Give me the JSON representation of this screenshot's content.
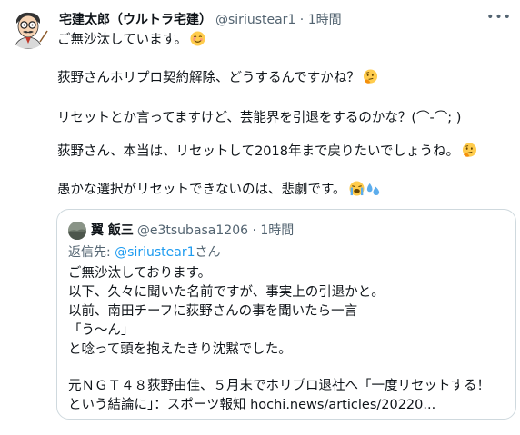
{
  "tweet": {
    "author_name": "宅建太郎（ウルトラ宅建）",
    "handle": "@siriustear1",
    "separator": "·",
    "time": "1時間",
    "lines": [
      "ご無沙汰しています。",
      "荻野さんホリプロ契約解除、どうするんですかね？",
      "リセットとか言ってますけど、芸能界を引退をするのかな？(⌒-⌒; )",
      "荻野さん、本当は、リセットして2018年まで戻りたいでしょうね。",
      "愚かな選択がリセットできないのは、悲劇です。"
    ],
    "emojis": [
      "smiling-face-emoji",
      "thinking-face-emoji",
      "thinking-face-emoji",
      "loudly-crying-face-emoji",
      "sweat-droplets-emoji"
    ]
  },
  "quoted_tweet": {
    "author_name": "翼 飯三",
    "handle": "@e3tsubasa1206",
    "separator": "·",
    "time": "1時間",
    "reply_prefix": "返信先: ",
    "reply_to": "@siriustear1",
    "reply_suffix": "さん",
    "lines": [
      "ご無沙汰しております。",
      "以下、久々に聞いた名前ですが、事実上の引退かと。",
      "以前、南田チーフに荻野さんの事を聞いたら一言",
      "「う～ん」",
      "と唸って頭を抱えたきり沈黙でした。",
      "元ＮＧＴ４８荻野由佳、５月末でホリプロ退社へ「一度リセットする！",
      "という結論に」：スポーツ報知 hochi.news/articles/20220..."
    ]
  },
  "icons": {
    "more": "more-dots-icon"
  },
  "colors": {
    "text": "#0f1419",
    "secondary": "#536471",
    "link": "#1d9bf0",
    "border": "#cfd9de"
  }
}
